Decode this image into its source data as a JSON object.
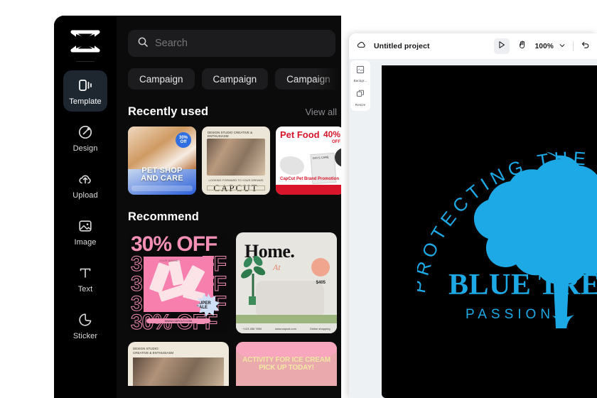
{
  "capcut": {
    "logo_icon": "capcut-logo-icon",
    "sidebar": {
      "items": [
        {
          "label": "Template",
          "icon": "template-icon",
          "active": true
        },
        {
          "label": "Design",
          "icon": "design-brush-icon",
          "active": false
        },
        {
          "label": "Upload",
          "icon": "cloud-upload-icon",
          "active": false
        },
        {
          "label": "Image",
          "icon": "image-icon",
          "active": false
        },
        {
          "label": "Text",
          "icon": "text-icon",
          "active": false
        },
        {
          "label": "Sticker",
          "icon": "sticker-icon",
          "active": false
        }
      ]
    },
    "search": {
      "placeholder": "Search",
      "value": "",
      "icon": "search-icon"
    },
    "chips": [
      "Campaign",
      "Campaign",
      "Campaign"
    ],
    "recently_used": {
      "title": "Recently used",
      "view_all": "View all",
      "next_icon": "chevron-right-icon",
      "items": [
        {
          "name": "pet-shop-and-care",
          "title_line1": "PET SHOP",
          "title_line2": "AND CARE",
          "badge": "30% Off"
        },
        {
          "name": "capcut-design-studio",
          "kicker": "DESIGN STUDIO CREATIVE & ENTHUSIASM",
          "subtitle": "LOOKING FORWARD TO YOUR DREAMS",
          "wordmark": "CAPCUT"
        },
        {
          "name": "pet-food-promo",
          "heading": "Pet Food",
          "discount": "40%",
          "discount_sub": "OFF",
          "brand": "CapCut Pet Brand Promotion",
          "pack_label": "DAYS CARE"
        }
      ]
    },
    "recommend": {
      "title": "Recommend",
      "items": [
        {
          "name": "thirty-percent-off",
          "headline": "30% OFF",
          "ghost_rows": [
            "3",
            "3",
            "3",
            "3"
          ],
          "ghost_suffix": "FF",
          "bottom_row": "30%  OFF",
          "badge": "SUPER SALE",
          "website": "WWW.CAPCUT.COM",
          "brand_tag": "YOUR BRAND"
        },
        {
          "name": "home-furniture",
          "headline": "Home.",
          "script": "At",
          "price": "$405",
          "footer_phone": "+123 456 7890",
          "footer_site": "www.capcut.com",
          "footer_note": "Online shopping"
        },
        {
          "name": "design-studio-people",
          "kicker_line1": "DESIGN STUDIO:",
          "kicker_line2": "CREATIVE & ENTHUSIASM"
        },
        {
          "name": "ice-cream-activity",
          "headline_line1": "ACTIVITY FOR ICE CREAM",
          "headline_line2": "PICK UP TODAY!"
        }
      ]
    }
  },
  "editor": {
    "topbar": {
      "cloud_icon": "cloud-sync-icon",
      "project_name": "Untitled project",
      "select_tool_icon": "cursor-select-icon",
      "hand_tool_icon": "hand-pan-icon",
      "zoom_level": "100%",
      "zoom_chevron_icon": "chevron-down-icon",
      "undo_icon": "undo-arrow-icon"
    },
    "left_tools": [
      {
        "label": "Backgr...",
        "icon": "background-icon"
      },
      {
        "label": "Resize",
        "icon": "resize-icon"
      }
    ],
    "canvas": {
      "background_color": "#000000",
      "accent_color": "#1CA9E5",
      "arc_text": "PROTECTING THE",
      "title": "BLUE TRE",
      "subtitle": "PASSION",
      "art_icon": "tree-silhouette-icon"
    }
  }
}
